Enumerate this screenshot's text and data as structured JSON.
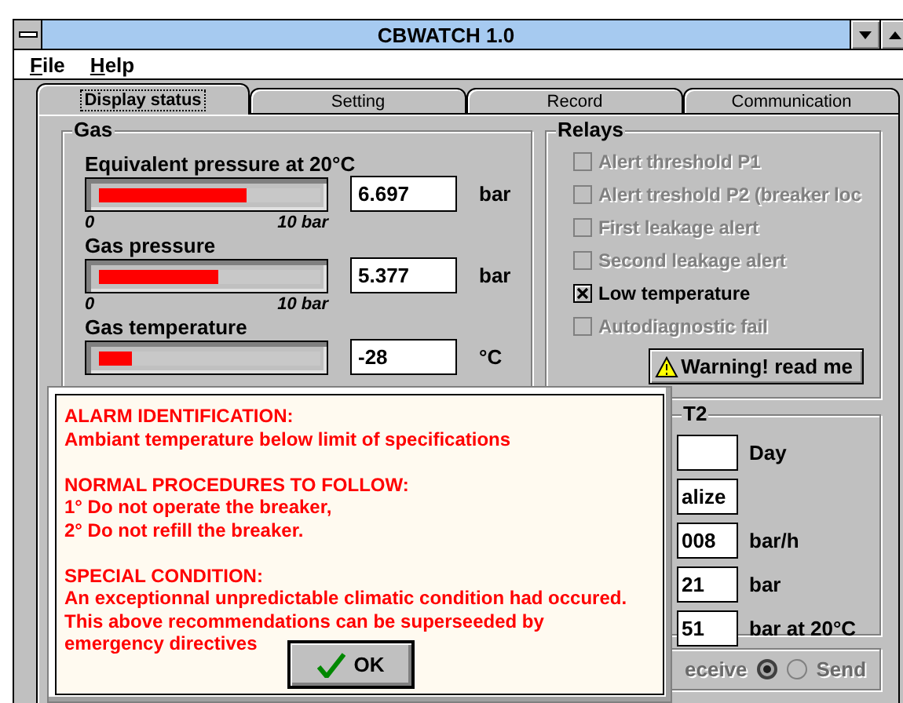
{
  "window": {
    "title": "CBWATCH 1.0"
  },
  "menu": [
    {
      "label": "File"
    },
    {
      "label": "Help"
    }
  ],
  "tabs": [
    {
      "label": "Display status",
      "selected": true
    },
    {
      "label": "Setting",
      "selected": false
    },
    {
      "label": "Record",
      "selected": false
    },
    {
      "label": "Communication",
      "selected": false
    }
  ],
  "gas": {
    "title": "Gas",
    "meters": [
      {
        "label": "Equivalent pressure at 20°C",
        "level": 0.67,
        "value": "6.697",
        "unit": "bar",
        "scale_min": "0",
        "scale_max": "10 bar"
      },
      {
        "label": "Gas pressure",
        "level": 0.54,
        "value": "5.377",
        "unit": "bar",
        "scale_min": "0",
        "scale_max": "10 bar"
      },
      {
        "label": "Gas temperature",
        "level": 0.15,
        "value": "-28",
        "unit": "°C"
      }
    ]
  },
  "relays": {
    "title": "Relays",
    "items": [
      {
        "label": "Alert threshold P1",
        "checked": false,
        "disabled": true
      },
      {
        "label": "Alert treshold P2 (breaker loc",
        "checked": false,
        "disabled": true
      },
      {
        "label": "First leakage alert",
        "checked": false,
        "disabled": true
      },
      {
        "label": "Second leakage alert",
        "checked": false,
        "disabled": true
      },
      {
        "label": "Low temperature",
        "checked": true,
        "disabled": false
      },
      {
        "label": "Autodiagnostic fail",
        "checked": false,
        "disabled": true
      }
    ],
    "warning_button": "Warning! read me"
  },
  "t2": {
    "title": "T2",
    "rows": [
      {
        "unit": "Day"
      },
      {
        "value": "alize"
      },
      {
        "value": "008",
        "unit": "bar/h"
      },
      {
        "value": "21",
        "unit": "bar"
      },
      {
        "value": "51",
        "unit": "bar at 20°C"
      }
    ]
  },
  "transfer": {
    "options": [
      {
        "label": "eceive",
        "selected": true
      },
      {
        "label": "Send",
        "selected": false
      }
    ],
    "disabled": true
  },
  "alarm_dialog": {
    "paragraphs": [
      [
        "ALARM IDENTIFICATION:",
        "Ambiant temperature below limit of specifications"
      ],
      [
        "NORMAL PROCEDURES TO FOLLOW:",
        "1° Do not operate the breaker,",
        "2° Do not refill the breaker."
      ],
      [
        "SPECIAL CONDITION:",
        "An exceptionnal unpredictable climatic condition had occured.",
        "This above recommendations can be superseeded by",
        "emergency directives"
      ]
    ],
    "ok_button": "OK"
  }
}
